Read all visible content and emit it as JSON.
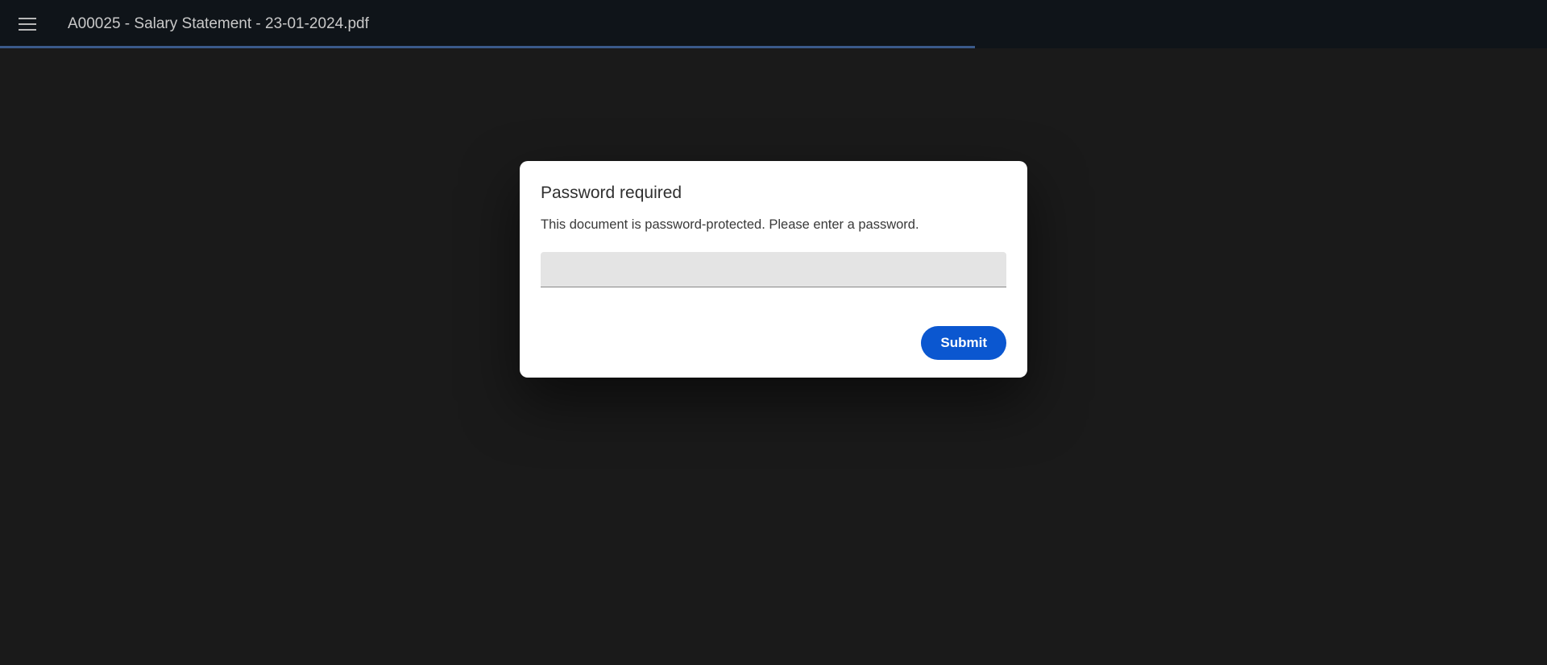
{
  "header": {
    "file_title": "A00025 - Salary Statement - 23-01-2024.pdf"
  },
  "dialog": {
    "title": "Password required",
    "message": "This document is password-protected. Please enter a password.",
    "password_value": "",
    "submit_label": "Submit"
  }
}
